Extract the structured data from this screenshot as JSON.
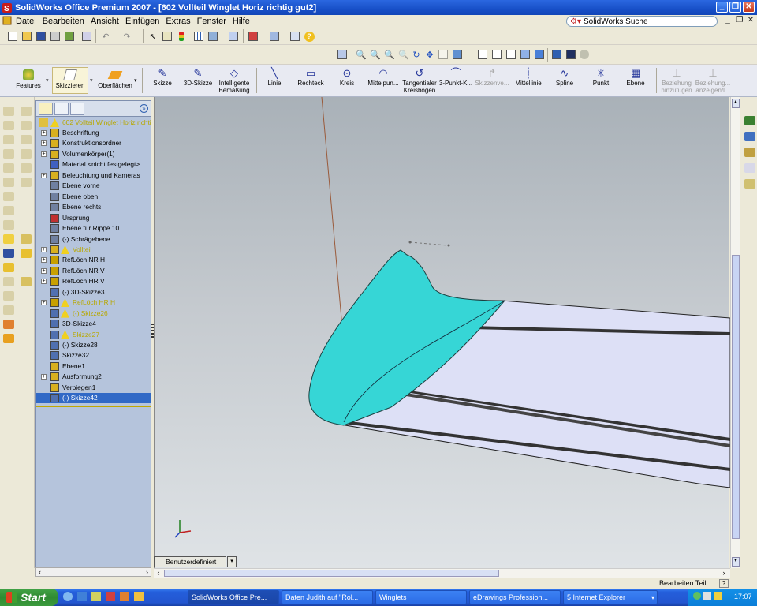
{
  "window": {
    "title": "SolidWorks Office Premium 2007 - [602 Vollteil Winglet Horiz richtig gut2]"
  },
  "menu": [
    "Datei",
    "Bearbeiten",
    "Ansicht",
    "Einfügen",
    "Extras",
    "Fenster",
    "Hilfe"
  ],
  "search": {
    "label": "SolidWorks Suche"
  },
  "command_tabs": {
    "features": "Features",
    "skizzieren": "Skizzieren",
    "oberflaechen": "Oberflächen"
  },
  "sketch_tools": [
    {
      "label": "Skizze",
      "icon": "sketch-icon"
    },
    {
      "label": "3D-Skizze",
      "icon": "3d-sketch-icon"
    },
    {
      "label": "Intelligente Bemaßung",
      "icon": "smart-dimension-icon"
    },
    {
      "label": "Linie",
      "icon": "line-icon"
    },
    {
      "label": "Rechteck",
      "icon": "rectangle-icon"
    },
    {
      "label": "Kreis",
      "icon": "circle-icon"
    },
    {
      "label": "Mittelpun...",
      "icon": "centerpoint-arc-icon"
    },
    {
      "label": "Tangentialer Kreisbogen",
      "icon": "tangent-arc-icon"
    },
    {
      "label": "3-Punkt-K...",
      "icon": "three-point-arc-icon"
    },
    {
      "label": "Skizzenve...",
      "icon": "sketch-fillet-icon"
    },
    {
      "label": "Mittellinie",
      "icon": "centerline-icon"
    },
    {
      "label": "Spline",
      "icon": "spline-icon"
    },
    {
      "label": "Punkt",
      "icon": "point-icon"
    },
    {
      "label": "Ebene",
      "icon": "plane-icon"
    },
    {
      "label": "Beziehung hinzufügen",
      "icon": "add-relation-icon"
    },
    {
      "label": "Beziehung... anzeigen/l...",
      "icon": "display-relation-icon"
    }
  ],
  "tree": {
    "root": "602 Vollteil Winglet Horiz richtig",
    "items": [
      {
        "label": "Beschriftung",
        "expand": true,
        "warn": false,
        "selected": false,
        "color": "#d8b020"
      },
      {
        "label": "Konstruktionsordner",
        "expand": true,
        "warn": false,
        "selected": false,
        "color": "#d8b020"
      },
      {
        "label": "Volumenkörper(1)",
        "expand": true,
        "warn": false,
        "selected": false,
        "color": "#d8b020"
      },
      {
        "label": "Material <nicht festgelegt>",
        "expand": false,
        "warn": false,
        "selected": false,
        "color": "#4060c0"
      },
      {
        "label": "Beleuchtung und Kameras",
        "expand": true,
        "warn": false,
        "selected": false,
        "color": "#d8b020"
      },
      {
        "label": "Ebene vorne",
        "expand": false,
        "warn": false,
        "selected": false,
        "color": "#7080a0"
      },
      {
        "label": "Ebene oben",
        "expand": false,
        "warn": false,
        "selected": false,
        "color": "#7080a0"
      },
      {
        "label": "Ebene rechts",
        "expand": false,
        "warn": false,
        "selected": false,
        "color": "#7080a0"
      },
      {
        "label": "Ursprung",
        "expand": false,
        "warn": false,
        "selected": false,
        "color": "#c03030"
      },
      {
        "label": "Ebene für Rippe 10",
        "expand": false,
        "warn": false,
        "selected": false,
        "color": "#7080a0"
      },
      {
        "label": "(-) Schrägebene",
        "expand": false,
        "warn": false,
        "selected": false,
        "color": "#7080a0"
      },
      {
        "label": "Vollteil",
        "expand": true,
        "warn": true,
        "selected": false,
        "color": "#d8b020"
      },
      {
        "label": "RefLöch NR H",
        "expand": true,
        "warn": false,
        "selected": false,
        "color": "#c8a000"
      },
      {
        "label": "RefLöch NR V",
        "expand": true,
        "warn": false,
        "selected": false,
        "color": "#c8a000"
      },
      {
        "label": "RefLöch HR V",
        "expand": true,
        "warn": false,
        "selected": false,
        "color": "#c8a000"
      },
      {
        "label": "(-) 3D-Skizze3",
        "expand": false,
        "warn": false,
        "selected": false,
        "color": "#5070b0"
      },
      {
        "label": "RefLöch HR H",
        "expand": true,
        "warn": true,
        "selected": false,
        "color": "#c8a000"
      },
      {
        "label": "(-) Skizze26",
        "expand": false,
        "warn": true,
        "selected": false,
        "color": "#5070b0"
      },
      {
        "label": "3D-Skizze4",
        "expand": false,
        "warn": false,
        "selected": false,
        "color": "#5070b0"
      },
      {
        "label": "Skizze27",
        "expand": false,
        "warn": true,
        "selected": false,
        "color": "#5070b0"
      },
      {
        "label": "(-) Skizze28",
        "expand": false,
        "warn": false,
        "selected": false,
        "color": "#5070b0"
      },
      {
        "label": "Skizze32",
        "expand": false,
        "warn": false,
        "selected": false,
        "color": "#5070b0"
      },
      {
        "label": "Ebene1",
        "expand": false,
        "warn": false,
        "selected": false,
        "color": "#d8b020"
      },
      {
        "label": "Ausformung2",
        "expand": true,
        "warn": false,
        "selected": false,
        "color": "#d8b020"
      },
      {
        "label": "Verbiegen1",
        "expand": false,
        "warn": false,
        "selected": false,
        "color": "#d8b020"
      },
      {
        "label": "(-) Skizze42",
        "expand": false,
        "warn": false,
        "selected": true,
        "color": "#5070b0"
      }
    ]
  },
  "viewport": {
    "view_tab": "Benutzerdefiniert",
    "model_color": "#36d6d6",
    "wing_color": "#dde0f6"
  },
  "status": {
    "text": "Bearbeiten Teil"
  },
  "taskbar": {
    "start": "Start",
    "tasks": [
      "SolidWorks Office Pre...",
      "Daten Judith auf \"Rol...",
      "Winglets",
      "eDrawings Profession...",
      "5 Internet Explorer"
    ],
    "clock": "17:07"
  }
}
